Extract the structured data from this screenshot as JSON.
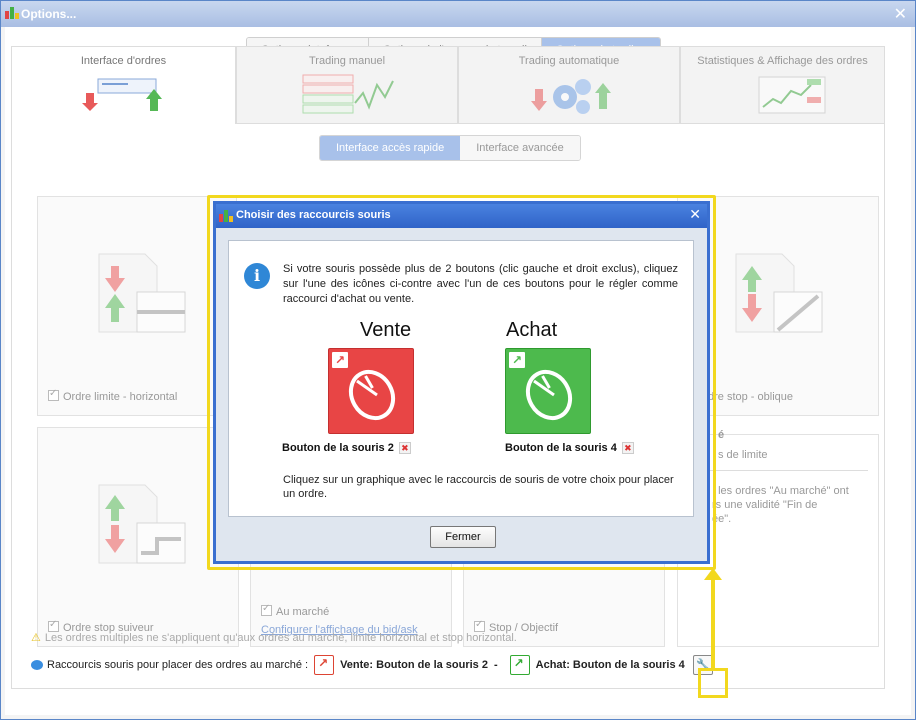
{
  "window": {
    "title": "Options..."
  },
  "top_tabs": [
    {
      "label": "Options plateforme",
      "active": false
    },
    {
      "label": "Options de l'espace de travail",
      "active": false
    },
    {
      "label": "Options de trading",
      "active": true
    }
  ],
  "section_tabs": [
    {
      "label": "Interface d'ordres",
      "active": true
    },
    {
      "label": "Trading manuel",
      "active": false
    },
    {
      "label": "Trading automatique",
      "active": false
    },
    {
      "label": "Statistiques & Affichage des ordres",
      "active": false
    }
  ],
  "pill_tabs": [
    {
      "label": "Interface accès rapide",
      "active": true
    },
    {
      "label": "Interface avancée",
      "active": false
    }
  ],
  "cards": {
    "limit_horizontal": "Ordre limite - horizontal",
    "stop_oblique": "dre stop - oblique",
    "trailing_stop": "Ordre stop suiveur",
    "market": "Au marché",
    "bid_ask_link": "Configurer l'affichage du bid/ask",
    "stop_target": "Stop / Objectif",
    "right_heading": "é",
    "right_sub": "s de limite",
    "right_para": ": les ordres \"Au marché\" ont\nrs une validité \"Fin de\née\"."
  },
  "footer": {
    "warning": "Les ordres multiples ne s'appliquent qu'aux ordres au marché, limite horizontal et stop horizontal.",
    "shortcut_prefix": "Raccourcis souris pour placer des ordres au marché :",
    "sell_label": "Vente: Bouton de la souris 2",
    "separator": "-",
    "buy_label": "Achat: Bouton de la souris 4"
  },
  "dialog": {
    "title": "Choisir des raccourcis souris",
    "info_text": "Si votre souris possède plus de 2 boutons (clic gauche et droit exclus), cliquez sur l'une des icônes ci-contre avec l'un de ces boutons pour le régler comme raccourci d'achat ou vente.",
    "sell_title": "Vente",
    "buy_title": "Achat",
    "sell_button": "Bouton de la souris 2",
    "buy_button": "Bouton de la souris 4",
    "bottom_text": "Cliquez sur un graphique avec le raccourcis de souris de votre choix pour placer un ordre.",
    "close_label": "Fermer"
  },
  "icons": {
    "sell_arrow": "↗",
    "buy_arrow": "↗",
    "delete": "✖",
    "close": "✕",
    "info": "i",
    "wrench": "🔧"
  },
  "colors": {
    "sell": "#e84545",
    "buy": "#4dba4d",
    "highlight": "#f2d81e",
    "dialog_border": "#3a6fd0"
  }
}
